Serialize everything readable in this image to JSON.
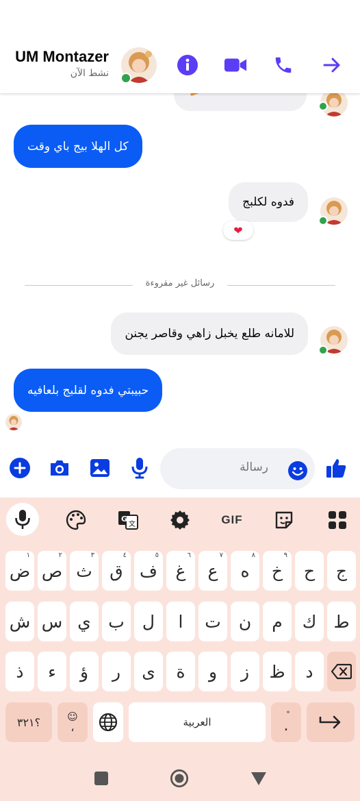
{
  "header": {
    "contact_name": "UM Montazer",
    "status": "نشط الآن"
  },
  "messages": [
    {
      "side": "incoming",
      "text": "",
      "note": "partially visible"
    },
    {
      "side": "outgoing",
      "text": "كل الهلا بيج باي وقت"
    },
    {
      "side": "incoming",
      "text": "فدوه لكلبج",
      "reaction": "❤"
    },
    {
      "side": "incoming",
      "text": "للامانه طلع يخبل زاهي وقاصر يجنن"
    },
    {
      "side": "outgoing",
      "text": "حبيبتي فدوه لقلبج بلعافيه"
    }
  ],
  "unread_divider": "رسائل غير مقروءة",
  "composer": {
    "placeholder": "رسالة"
  },
  "keyboard": {
    "row1": [
      {
        "k": "ج",
        "h": ""
      },
      {
        "k": "ح",
        "h": ""
      },
      {
        "k": "خ",
        "h": "٩"
      },
      {
        "k": "ه",
        "h": "٨"
      },
      {
        "k": "ع",
        "h": "٧"
      },
      {
        "k": "غ",
        "h": "٦"
      },
      {
        "k": "ف",
        "h": "٥"
      },
      {
        "k": "ق",
        "h": "٤"
      },
      {
        "k": "ث",
        "h": "٣"
      },
      {
        "k": "ص",
        "h": "٢"
      },
      {
        "k": "ض",
        "h": "١"
      }
    ],
    "row2": [
      "ط",
      "ك",
      "م",
      "ن",
      "ت",
      "ا",
      "ل",
      "ب",
      "ي",
      "س",
      "ش"
    ],
    "row3": [
      "د",
      "ظ",
      "ز",
      "و",
      "ة",
      "ى",
      "ر",
      "ؤ",
      "ء",
      "ذ"
    ],
    "numbers_key": "؟٣٢١",
    "comma_key": "،",
    "space_label": "العربية",
    "period_key": "."
  }
}
